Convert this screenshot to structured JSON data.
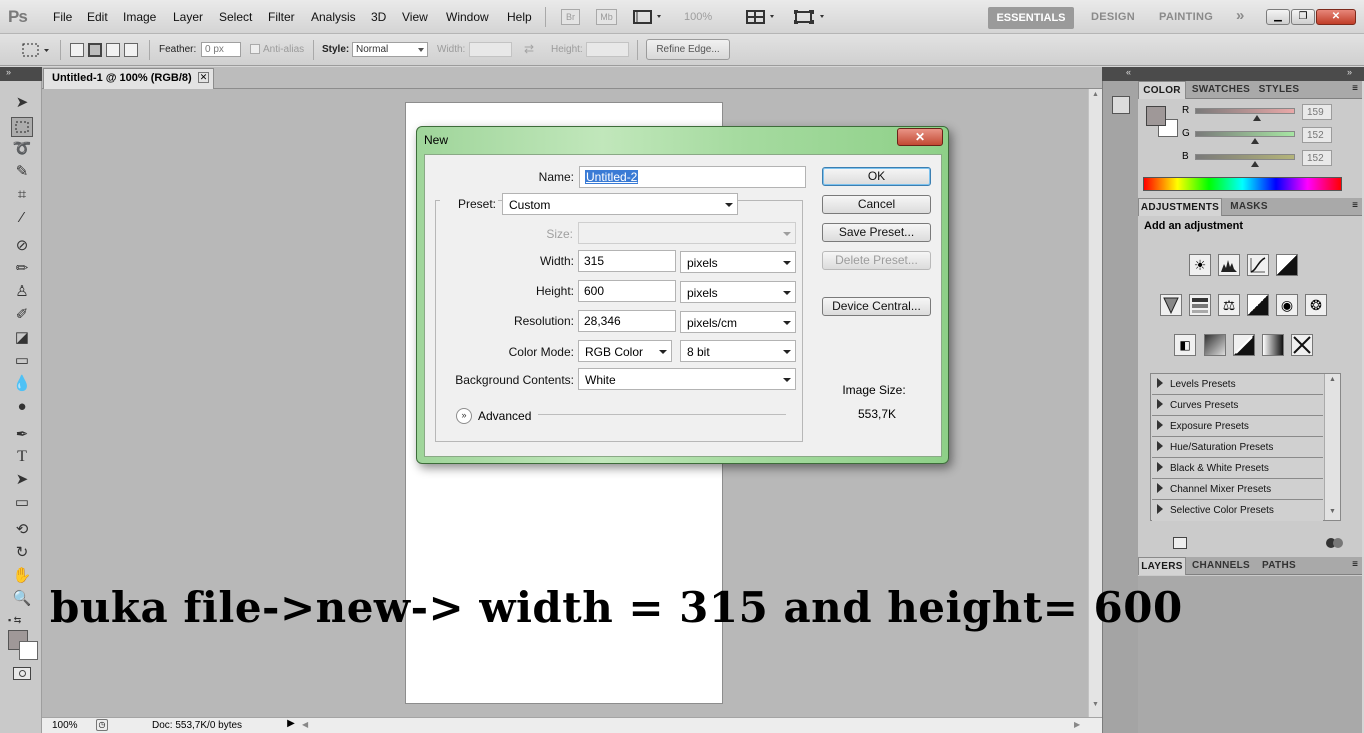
{
  "app": {
    "logo": "Ps"
  },
  "menu": [
    "File",
    "Edit",
    "Image",
    "Layer",
    "Select",
    "Filter",
    "Analysis",
    "3D",
    "View",
    "Window",
    "Help"
  ],
  "menubar_extras": {
    "bridge": "Br",
    "minibridge": "Mb",
    "zoom": "100%"
  },
  "workspaces": {
    "active": "ESSENTIALS",
    "others": [
      "DESIGN",
      "PAINTING"
    ],
    "more": "»"
  },
  "window_controls": {
    "minimize": "▁",
    "restore": "❐",
    "close": "✕"
  },
  "options_bar": {
    "feather_label": "Feather:",
    "feather_value": "0 px",
    "antialias_label": "Anti-alias",
    "style_label": "Style:",
    "style_value": "Normal",
    "width_label": "Width:",
    "height_label": "Height:",
    "refine_edge": "Refine Edge..."
  },
  "document": {
    "tab_title": "Untitled-1 @ 100% (RGB/8)",
    "tab_close": "✕"
  },
  "status_bar": {
    "zoom": "100%",
    "doc_info": "Doc: 553,7K/0 bytes"
  },
  "caption": "buka file->new-> width = 315 and height= 600",
  "color_panel": {
    "tabs": [
      "COLOR",
      "SWATCHES",
      "STYLES"
    ],
    "channels": [
      {
        "label": "R",
        "value": "159",
        "fill": 0.62,
        "gradient": "#e9a8a8"
      },
      {
        "label": "G",
        "value": "152",
        "fill": 0.6,
        "gradient": "#a7e6a3"
      },
      {
        "label": "B",
        "value": "152",
        "fill": 0.6,
        "gradient": "#b4b47a"
      }
    ],
    "foreground": "#9f9898",
    "background": "#ffffff"
  },
  "adjustments_panel": {
    "tabs": [
      "ADJUSTMENTS",
      "MASKS"
    ],
    "heading": "Add an adjustment",
    "presets": [
      "Levels Presets",
      "Curves Presets",
      "Exposure Presets",
      "Hue/Saturation Presets",
      "Black & White Presets",
      "Channel Mixer Presets",
      "Selective Color Presets"
    ]
  },
  "layers_panel": {
    "tabs": [
      "LAYERS",
      "CHANNELS",
      "PATHS"
    ]
  },
  "dialog": {
    "title": "New",
    "close": "✕",
    "name_label": "Name:",
    "name_value": "Untitled-2",
    "preset_label": "Preset:",
    "preset_value": "Custom",
    "size_label": "Size:",
    "width_label": "Width:",
    "width_value": "315",
    "width_unit": "pixels",
    "height_label": "Height:",
    "height_value": "600",
    "height_unit": "pixels",
    "resolution_label": "Resolution:",
    "resolution_value": "28,346",
    "resolution_unit": "pixels/cm",
    "color_mode_label": "Color Mode:",
    "color_mode_value": "RGB Color",
    "bit_depth": "8 bit",
    "background_label": "Background Contents:",
    "background_value": "White",
    "advanced_label": "Advanced",
    "advanced_chevron": "»",
    "buttons": {
      "ok": "OK",
      "cancel": "Cancel",
      "save_preset": "Save Preset...",
      "delete_preset": "Delete Preset...",
      "device_central": "Device Central..."
    },
    "image_size_label": "Image Size:",
    "image_size_value": "553,7K"
  }
}
